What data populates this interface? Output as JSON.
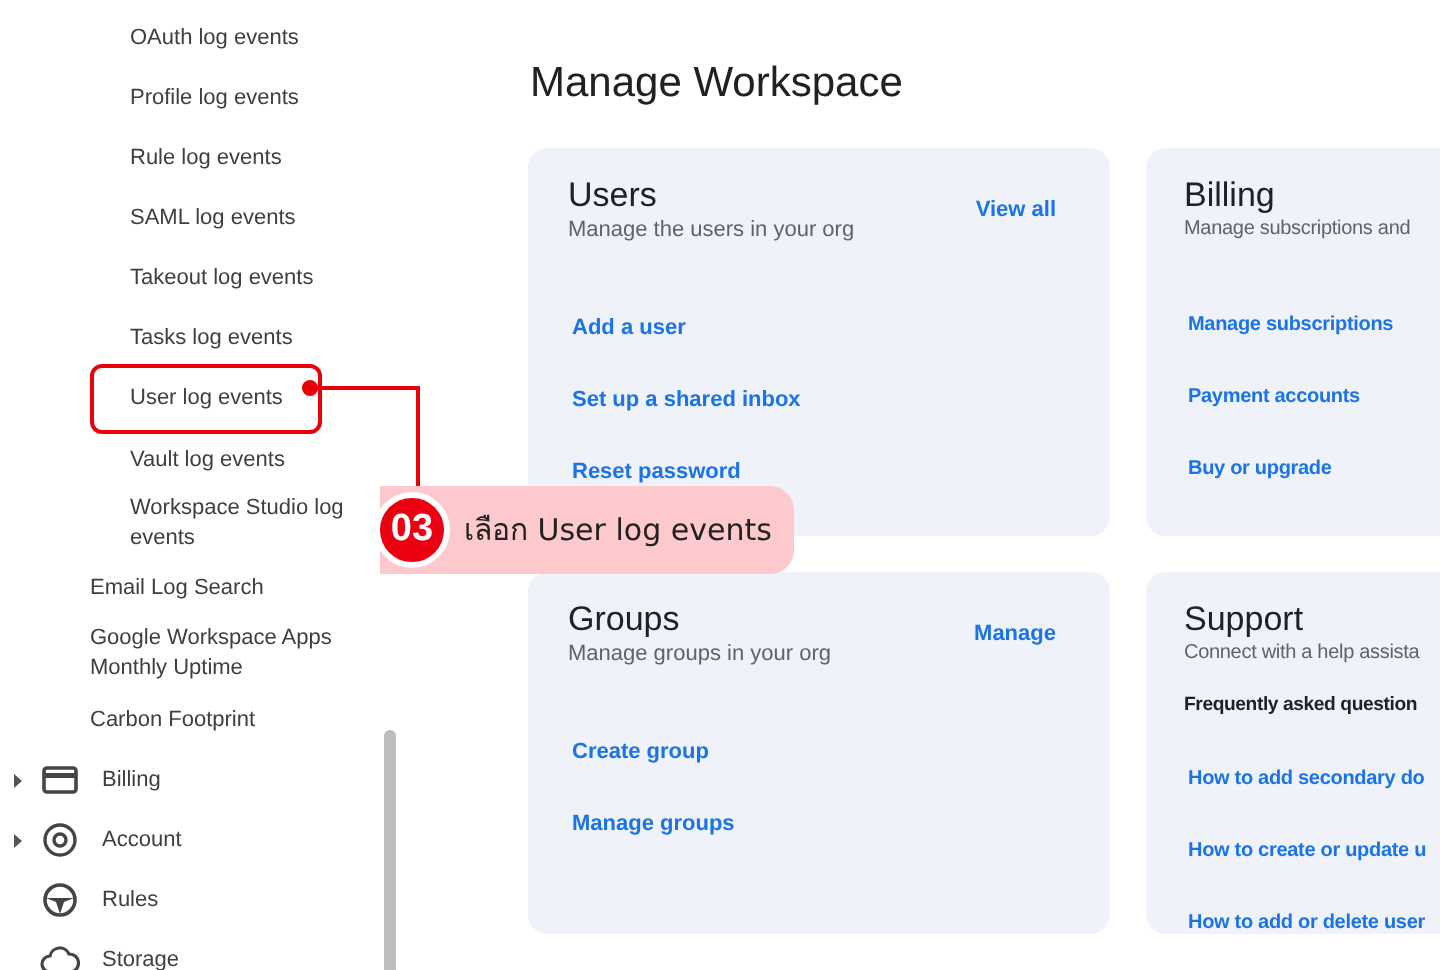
{
  "sidebar": {
    "items": [
      {
        "kind": "subitem",
        "label": "OAuth log events",
        "highlighted": false
      },
      {
        "kind": "subitem",
        "label": "Profile log events",
        "highlighted": false
      },
      {
        "kind": "subitem",
        "label": "Rule log events",
        "highlighted": false
      },
      {
        "kind": "subitem",
        "label": "SAML log events",
        "highlighted": false
      },
      {
        "kind": "subitem",
        "label": "Takeout log events",
        "highlighted": false
      },
      {
        "kind": "subitem",
        "label": "Tasks log events",
        "highlighted": false
      },
      {
        "kind": "subitem",
        "label": "User log events",
        "highlighted": true
      },
      {
        "kind": "subitem",
        "label": "Vault log events",
        "highlighted": false
      },
      {
        "kind": "subitem",
        "label": "Workspace Studio log events",
        "highlighted": false
      },
      {
        "kind": "item",
        "label": "Email Log Search"
      },
      {
        "kind": "item",
        "label": "Google Workspace Apps Monthly Uptime"
      },
      {
        "kind": "item",
        "label": "Carbon Footprint"
      },
      {
        "kind": "section",
        "label": "Billing",
        "expandable": true
      },
      {
        "kind": "section",
        "label": "Account",
        "expandable": true
      },
      {
        "kind": "section",
        "label": "Rules",
        "expandable": false
      },
      {
        "kind": "section",
        "label": "Storage",
        "expandable": false
      }
    ]
  },
  "callout": {
    "number": "03",
    "text": "เลือก User log events"
  },
  "page_title": "Manage Workspace",
  "cards": [
    {
      "title": "Users",
      "subtitle": "Manage the users in your org",
      "action": "View all",
      "links": [
        "Add a user",
        "Set up a shared inbox",
        "Reset password"
      ]
    },
    {
      "title": "Billing",
      "subtitle": "Manage subscriptions and",
      "links": [
        "Manage subscriptions",
        "Payment accounts",
        "Buy or upgrade"
      ]
    },
    {
      "title": "Groups",
      "subtitle": "Manage groups in your org",
      "action": "Manage",
      "links": [
        "Create group",
        "Manage groups"
      ]
    },
    {
      "title": "Support",
      "subtitle": "Connect with a help assista",
      "heading": "Frequently asked question",
      "links": [
        "How to add secondary do",
        "How to create or update u",
        "How to add or delete user"
      ]
    }
  ]
}
